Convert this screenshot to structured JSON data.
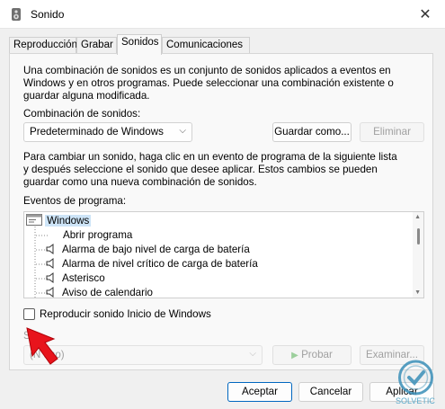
{
  "window": {
    "title": "Sonido",
    "close_glyph": "✕"
  },
  "tabs": [
    {
      "label": "Reproducción",
      "active": false
    },
    {
      "label": "Grabar",
      "active": false
    },
    {
      "label": "Sonidos",
      "active": true
    },
    {
      "label": "Comunicaciones",
      "active": false
    }
  ],
  "intro": {
    "line1": "Una combinación de sonidos es un conjunto de sonidos aplicados a eventos en",
    "line2": "Windows y en otros programas. Puede seleccionar una combinación existente o",
    "line3": "guardar alguna modificada."
  },
  "scheme": {
    "label": "Combinación de sonidos:",
    "value": "Predeterminado de Windows",
    "save_button": "Guardar como...",
    "delete_button": "Eliminar"
  },
  "instructions": {
    "line1": "Para cambiar un sonido, haga clic en un evento de programa de la siguiente lista",
    "line2": "y después seleccione el sonido que desee aplicar. Estos cambios se pueden",
    "line3": "guardar como una nueva combinación de sonidos."
  },
  "events": {
    "label": "Eventos de programa:",
    "group": "Windows",
    "items": [
      {
        "label": "Abrir programa",
        "has_sound": false
      },
      {
        "label": "Alarma de bajo nivel de carga de batería",
        "has_sound": true
      },
      {
        "label": "Alarma de nivel crítico de carga de batería",
        "has_sound": true
      },
      {
        "label": "Asterisco",
        "has_sound": true
      },
      {
        "label": "Aviso de calendario",
        "has_sound": true
      }
    ]
  },
  "startup_checkbox": {
    "label": "Reproducir sonido Inicio de Windows",
    "checked": false
  },
  "sounds": {
    "label": "Sonidos:",
    "label_visible": "S        s:",
    "value": "(Ninguno)",
    "value_visible": "(N      uno)",
    "test_button": "Probar",
    "browse_button": "Examinar..."
  },
  "footer": {
    "accept": "Aceptar",
    "cancel": "Cancelar",
    "apply": "Aplicar"
  },
  "watermark": {
    "text": "SOLVETIC"
  },
  "colors": {
    "accent": "#0067c0",
    "arrow": "#e8141c",
    "watermark": "#3a8fb8"
  }
}
